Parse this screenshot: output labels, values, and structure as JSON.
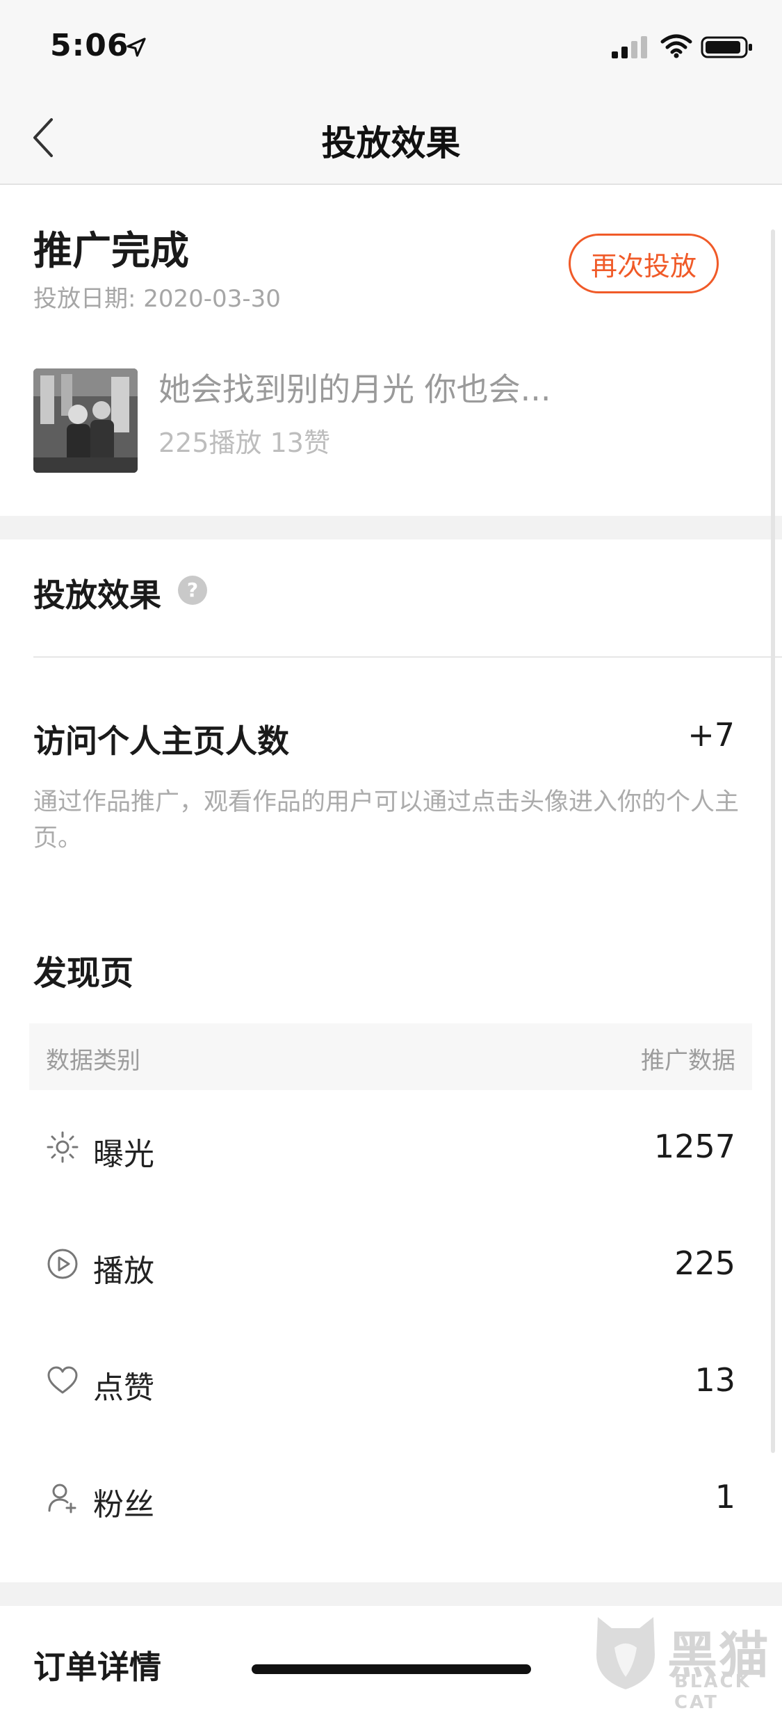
{
  "status_bar": {
    "time": "5:06",
    "icons": [
      "location-arrow-icon",
      "signal-icon",
      "wifi-icon",
      "battery-icon"
    ]
  },
  "nav": {
    "title": "投放效果",
    "back_icon": "chevron-left-icon"
  },
  "promotion": {
    "status": "推广完成",
    "date": "投放日期: 2020-03-30",
    "again_button": "再次投放",
    "video": {
      "title": "她会找到别的月光 你也会...",
      "stats": "225播放 13赞"
    }
  },
  "effect": {
    "heading": "投放效果",
    "help_icon": "question-circle-icon",
    "visits": {
      "label": "访问个人主页人数",
      "value": "+7",
      "description": "通过作品推广，观看作品的用户可以通过点击头像进入你的个人主页。"
    }
  },
  "discover": {
    "title": "发现页",
    "table": {
      "header_left": "数据类别",
      "header_right": "推广数据",
      "rows": [
        {
          "icon": "sun-icon",
          "label": "曝光",
          "value": "1257"
        },
        {
          "icon": "play-circle-icon",
          "label": "播放",
          "value": "225"
        },
        {
          "icon": "heart-icon",
          "label": "点赞",
          "value": "13"
        },
        {
          "icon": "user-plus-icon",
          "label": "粉丝",
          "value": "1"
        }
      ]
    }
  },
  "order": {
    "title": "订单详情"
  },
  "watermark": {
    "text_cn": "黑猫",
    "text_en": "BLACK CAT"
  },
  "colors": {
    "accent": "#f05a28",
    "muted_text": "#a6a6a6",
    "background_gray": "#f7f7f7"
  }
}
